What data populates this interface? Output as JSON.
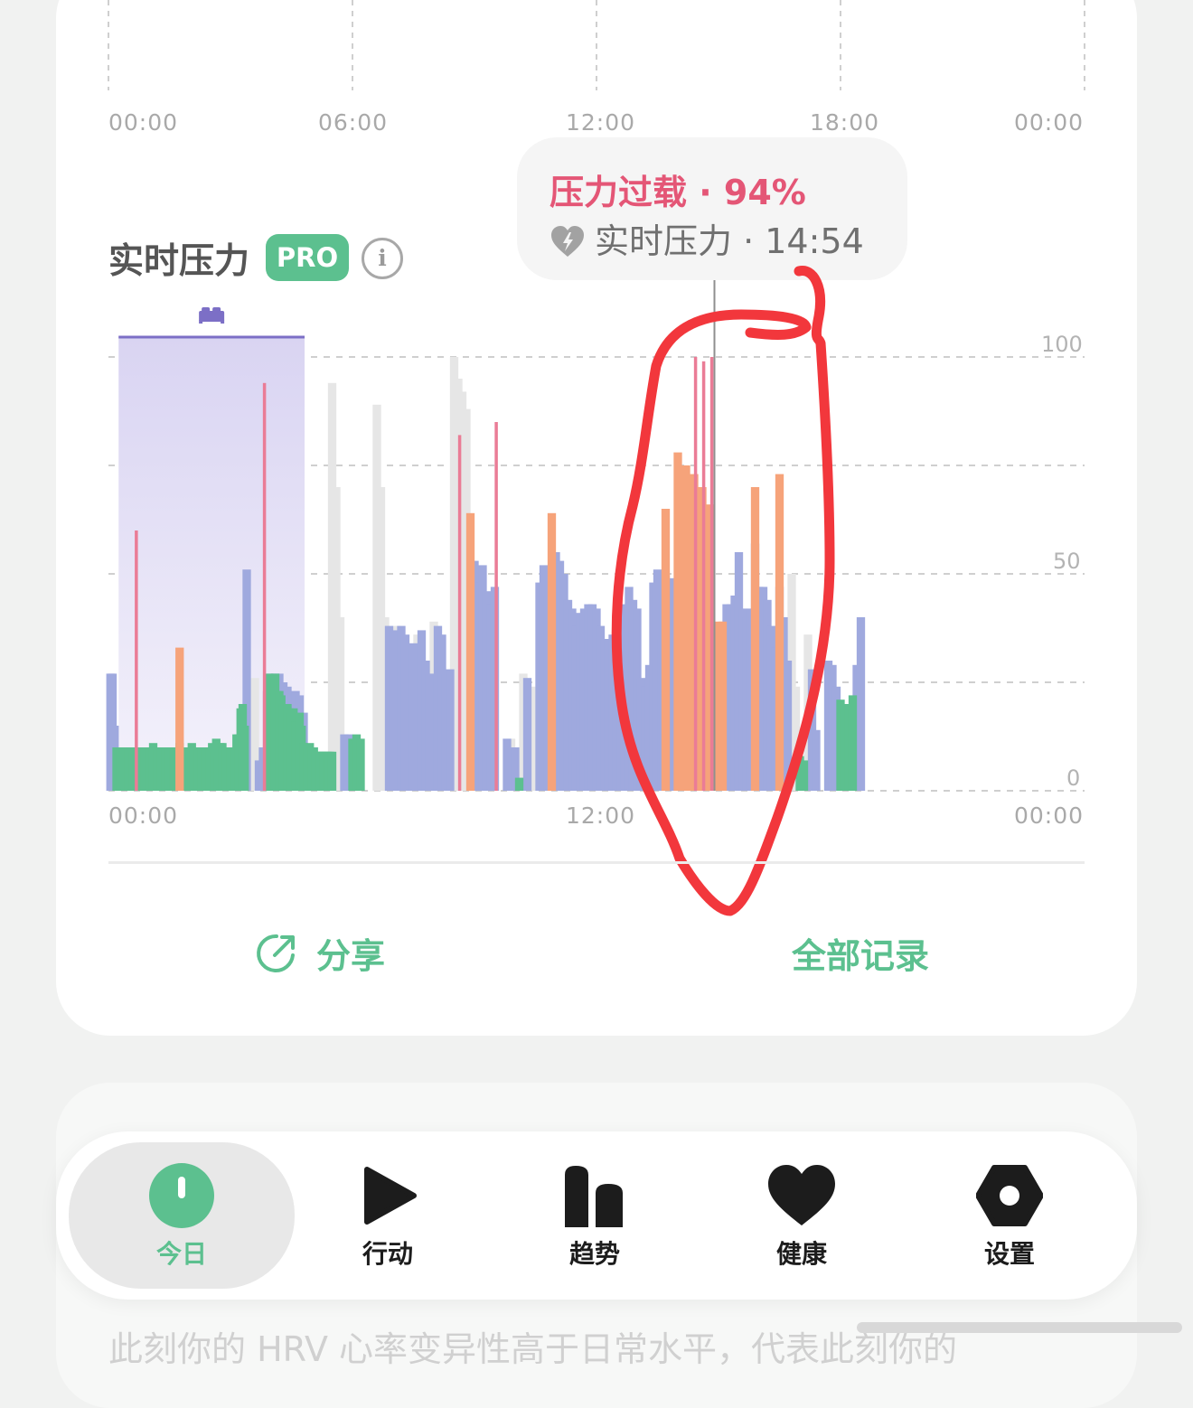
{
  "top_axis": {
    "ticks": [
      "00:00",
      "06:00",
      "12:00",
      "18:00",
      "00:00"
    ]
  },
  "section": {
    "title": "实时压力",
    "badge": "PRO",
    "info_glyph": "i"
  },
  "tooltip": {
    "status": "压力过载 · 94%",
    "label": "实时压力 · 14:54",
    "status_color": "#e45676",
    "icon": "heart-bolt-icon"
  },
  "sleep_icon": "bed-icon",
  "colors": {
    "accent": "#5cc08f",
    "calm": "#5cc08f",
    "normal": "#9fa9de",
    "medium": "#f6a37a",
    "high": "#ea7c96",
    "no_data": "#e6e6e6",
    "sleep": "#7c6fc6",
    "annotation": "#f2373c"
  },
  "chart_data": {
    "type": "bar",
    "x_range": [
      "00:00",
      "24:00"
    ],
    "xticks": [
      "00:00",
      "12:00",
      "00:00"
    ],
    "yticks": [
      0,
      50,
      100
    ],
    "ylim": [
      0,
      100
    ],
    "grid": true,
    "sleep_period": {
      "start": "00:15",
      "end": "05:00"
    },
    "cursor": {
      "time": "14:54",
      "value": 94
    },
    "bars": [
      [
        0.1,
        27,
        "n"
      ],
      [
        0.2,
        27,
        "n"
      ],
      [
        0.3,
        15,
        "n"
      ],
      [
        0.4,
        10,
        "g"
      ],
      [
        0.5,
        10,
        "g"
      ],
      [
        0.6,
        10,
        "g"
      ],
      [
        0.7,
        10,
        "g"
      ],
      [
        0.8,
        10,
        "n"
      ],
      [
        0.9,
        10,
        "g"
      ],
      [
        1.0,
        10,
        "g"
      ],
      [
        1.1,
        10,
        "g"
      ],
      [
        1.2,
        9,
        "g"
      ],
      [
        1.3,
        9,
        "g"
      ],
      [
        1.4,
        10,
        "g"
      ],
      [
        1.5,
        10,
        "g"
      ],
      [
        1.6,
        10,
        "g"
      ],
      [
        1.7,
        10,
        "g"
      ],
      [
        1.8,
        10,
        "g"
      ],
      [
        1.9,
        10,
        "g"
      ],
      [
        2.0,
        10,
        "g"
      ],
      [
        2.1,
        10,
        "g"
      ],
      [
        2.2,
        11,
        "g"
      ],
      [
        2.3,
        10,
        "g"
      ],
      [
        2.4,
        10,
        "g"
      ],
      [
        2.5,
        10,
        "g"
      ],
      [
        2.6,
        10,
        "g"
      ],
      [
        2.7,
        10,
        "g"
      ],
      [
        2.8,
        10,
        "g"
      ],
      [
        2.9,
        10,
        "g"
      ],
      [
        3.0,
        10,
        "g"
      ],
      [
        3.1,
        10,
        "g"
      ],
      [
        3.2,
        10,
        "g"
      ],
      [
        3.3,
        10,
        "g"
      ],
      [
        3.4,
        10,
        "g"
      ],
      [
        3.5,
        11,
        "g"
      ],
      [
        3.6,
        10,
        "g"
      ],
      [
        3.7,
        10,
        "g"
      ],
      [
        3.8,
        10,
        "g"
      ],
      [
        3.9,
        10,
        "g"
      ],
      [
        4.0,
        10,
        "g"
      ],
      [
        4.1,
        11,
        "g"
      ],
      [
        4.2,
        10,
        "g"
      ],
      [
        4.3,
        10,
        "g"
      ],
      [
        4.4,
        10,
        "g"
      ],
      [
        4.5,
        10,
        "g"
      ],
      [
        4.6,
        10,
        "g"
      ],
      [
        4.7,
        10,
        "g"
      ],
      [
        4.8,
        10,
        "g"
      ],
      [
        4.9,
        10,
        "g"
      ],
      [
        5.0,
        10,
        "g"
      ],
      [
        5.1,
        11,
        "g"
      ],
      [
        5.2,
        9,
        "g"
      ],
      [
        5.3,
        12,
        "g"
      ],
      [
        5.4,
        8,
        "g"
      ],
      [
        5.5,
        11,
        "g"
      ],
      [
        5.6,
        11,
        "g"
      ],
      [
        5.7,
        10,
        "g"
      ],
      [
        5.8,
        10,
        "g"
      ],
      [
        5.9,
        10,
        "g"
      ],
      [
        6.0,
        10,
        "g"
      ],
      [
        6.1,
        10,
        "g"
      ],
      [
        6.2,
        10,
        "g"
      ],
      [
        6.3,
        13,
        "g"
      ],
      [
        6.4,
        13,
        "g"
      ],
      [
        6.5,
        19,
        "g"
      ],
      [
        6.6,
        20,
        "g"
      ],
      [
        6.7,
        15,
        "g"
      ],
      [
        6.8,
        51,
        "n"
      ],
      [
        1.5,
        60,
        "r"
      ],
      [
        3.5,
        33,
        "o"
      ],
      [
        5.8,
        6,
        "n"
      ],
      [
        6.0,
        8,
        "n"
      ],
      [
        6.2,
        3,
        "n"
      ],
      [
        6.4,
        10,
        "n"
      ],
      [
        7.0,
        20,
        "e"
      ],
      [
        7.2,
        26,
        "e"
      ],
      [
        7.4,
        7,
        "n"
      ],
      [
        7.6,
        10,
        "n"
      ],
      [
        7.8,
        23,
        "n"
      ],
      [
        8.0,
        27,
        "n"
      ],
      [
        8.2,
        27,
        "n"
      ],
      [
        8.4,
        27,
        "n"
      ],
      [
        8.6,
        25,
        "n"
      ],
      [
        8.8,
        24,
        "n"
      ],
      [
        9.0,
        20,
        "n"
      ],
      [
        9.2,
        23,
        "n"
      ],
      [
        9.4,
        22,
        "n"
      ],
      [
        9.6,
        18,
        "n"
      ],
      [
        7.8,
        94,
        "r"
      ],
      [
        7.9,
        27,
        "g"
      ],
      [
        8.0,
        25,
        "g"
      ],
      [
        8.1,
        26,
        "g"
      ],
      [
        8.2,
        27,
        "g"
      ],
      [
        8.3,
        23,
        "g"
      ],
      [
        8.4,
        23,
        "g"
      ],
      [
        8.5,
        22,
        "g"
      ],
      [
        8.6,
        20,
        "g"
      ],
      [
        8.7,
        20,
        "g"
      ],
      [
        8.8,
        20,
        "g"
      ],
      [
        8.9,
        19,
        "g"
      ],
      [
        9.0,
        18,
        "g"
      ],
      [
        9.1,
        19,
        "g"
      ],
      [
        9.2,
        16,
        "g"
      ],
      [
        9.3,
        16,
        "g"
      ],
      [
        9.4,
        18,
        "g"
      ],
      [
        9.5,
        15,
        "g"
      ],
      [
        9.6,
        11,
        "g"
      ],
      [
        9.7,
        10,
        "g"
      ],
      [
        9.8,
        10,
        "g"
      ],
      [
        9.9,
        11,
        "g"
      ],
      [
        10.0,
        10,
        "g"
      ],
      [
        10.1,
        10,
        "g"
      ],
      [
        10.2,
        9,
        "g"
      ],
      [
        10.3,
        9,
        "g"
      ],
      [
        10.4,
        9,
        "g"
      ],
      [
        10.5,
        9,
        "g"
      ],
      [
        10.6,
        9,
        "g"
      ],
      [
        10.7,
        9,
        "g"
      ],
      [
        10.8,
        9,
        "g"
      ],
      [
        10.9,
        9,
        "g"
      ],
      [
        11.0,
        9,
        "g"
      ],
      [
        11.0,
        94,
        "e"
      ],
      [
        11.2,
        70,
        "e"
      ],
      [
        11.4,
        40,
        "e"
      ],
      [
        11.6,
        13,
        "n"
      ],
      [
        11.8,
        13,
        "n"
      ],
      [
        12.0,
        12,
        "g"
      ],
      [
        12.2,
        13,
        "g"
      ],
      [
        12.4,
        12,
        "g"
      ],
      [
        13.2,
        89,
        "e"
      ],
      [
        13.4,
        70,
        "e"
      ],
      [
        13.6,
        40,
        "e"
      ],
      [
        13.8,
        38,
        "n"
      ],
      [
        14.0,
        37,
        "n"
      ],
      [
        14.2,
        38,
        "e"
      ],
      [
        14.4,
        38,
        "n"
      ],
      [
        14.6,
        36,
        "n"
      ],
      [
        14.8,
        33,
        "e"
      ],
      [
        15.0,
        34,
        "n"
      ],
      [
        15.2,
        36,
        "e"
      ],
      [
        15.4,
        37,
        "n"
      ],
      [
        15.6,
        30,
        "n"
      ],
      [
        15.8,
        27,
        "n"
      ],
      [
        16.0,
        39,
        "e"
      ],
      [
        16.2,
        38,
        "n"
      ],
      [
        16.4,
        36,
        "n"
      ],
      [
        16.6,
        27,
        "n"
      ],
      [
        16.8,
        28,
        "n"
      ],
      [
        17.0,
        100,
        "e"
      ],
      [
        17.2,
        95,
        "e"
      ],
      [
        17.4,
        92,
        "e"
      ],
      [
        17.6,
        88,
        "e"
      ],
      [
        17.8,
        64,
        "o"
      ],
      [
        18.0,
        53,
        "n"
      ],
      [
        18.2,
        48,
        "n"
      ],
      [
        18.4,
        52,
        "n"
      ],
      [
        18.6,
        46,
        "n"
      ],
      [
        18.8,
        43,
        "n"
      ],
      [
        19.0,
        47,
        "n"
      ],
      [
        17.4,
        82,
        "r"
      ],
      [
        19.2,
        85,
        "r"
      ],
      [
        19.6,
        12,
        "n"
      ],
      [
        19.8,
        12,
        "e"
      ],
      [
        20.0,
        10,
        "n"
      ],
      [
        20.2,
        3,
        "g"
      ],
      [
        20.4,
        27,
        "e"
      ],
      [
        20.6,
        26,
        "n"
      ],
      [
        20.8,
        24,
        "e"
      ],
      [
        21.0,
        22,
        "e"
      ],
      [
        21.2,
        48,
        "n"
      ],
      [
        21.4,
        52,
        "n"
      ],
      [
        21.6,
        45,
        "n"
      ],
      [
        21.8,
        64,
        "o"
      ],
      [
        22.0,
        55,
        "n"
      ],
      [
        22.2,
        53,
        "n"
      ],
      [
        22.4,
        50,
        "n"
      ],
      [
        22.6,
        44,
        "n"
      ],
      [
        22.8,
        42,
        "n"
      ],
      [
        23.0,
        38,
        "n"
      ],
      [
        23.2,
        41,
        "n"
      ],
      [
        23.4,
        42,
        "n"
      ],
      [
        23.6,
        43,
        "n"
      ],
      [
        23.8,
        43,
        "n"
      ],
      [
        24.0,
        42,
        "n"
      ],
      [
        24.2,
        38,
        "n"
      ],
      [
        24.4,
        35,
        "n"
      ],
      [
        24.6,
        35,
        "n"
      ],
      [
        24.8,
        36,
        "n"
      ],
      [
        25.0,
        38,
        "n"
      ],
      [
        25.2,
        43,
        "n"
      ],
      [
        25.4,
        35,
        "n"
      ],
      [
        25.6,
        47,
        "n"
      ],
      [
        25.8,
        44,
        "n"
      ],
      [
        26.0,
        42,
        "n"
      ],
      [
        26.2,
        26,
        "n"
      ],
      [
        26.4,
        24,
        "n"
      ],
      [
        26.6,
        29,
        "n"
      ],
      [
        26.8,
        48,
        "n"
      ],
      [
        27.0,
        51,
        "n"
      ],
      [
        27.2,
        35,
        "n"
      ],
      [
        27.4,
        50,
        "n"
      ],
      [
        27.6,
        49,
        "n"
      ],
      [
        27.8,
        40,
        "n"
      ],
      [
        28.0,
        42,
        "n"
      ],
      [
        27.4,
        65,
        "o"
      ],
      [
        28.2,
        64,
        "o"
      ],
      [
        28.6,
        64,
        "o"
      ],
      [
        28.8,
        47,
        "o"
      ],
      [
        29.0,
        100,
        "r"
      ],
      [
        29.2,
        50,
        "o"
      ],
      [
        29.4,
        99,
        "r"
      ],
      [
        29.6,
        66,
        "o"
      ],
      [
        29.8,
        100,
        "r"
      ],
      [
        30.0,
        39,
        "o"
      ],
      [
        30.2,
        39,
        "o"
      ],
      [
        28.0,
        78,
        "o"
      ],
      [
        28.4,
        75,
        "o"
      ],
      [
        28.8,
        73,
        "o"
      ],
      [
        29.2,
        70,
        "o"
      ],
      [
        29.6,
        64,
        "o"
      ],
      [
        30.4,
        43,
        "n"
      ],
      [
        30.6,
        43,
        "n"
      ],
      [
        30.8,
        45,
        "n"
      ],
      [
        31.0,
        55,
        "n"
      ],
      [
        31.2,
        42,
        "n"
      ],
      [
        31.4,
        40,
        "n"
      ],
      [
        31.6,
        42,
        "n"
      ],
      [
        31.8,
        57,
        "n"
      ],
      [
        32.0,
        47,
        "n"
      ],
      [
        32.2,
        47,
        "n"
      ],
      [
        32.4,
        44,
        "n"
      ],
      [
        32.6,
        38,
        "n"
      ],
      [
        32.8,
        33,
        "n"
      ],
      [
        33.0,
        47,
        "n"
      ],
      [
        33.2,
        40,
        "n"
      ],
      [
        33.4,
        30,
        "n"
      ],
      [
        31.8,
        70,
        "o"
      ],
      [
        33.0,
        73,
        "o"
      ],
      [
        33.6,
        50,
        "e"
      ],
      [
        33.8,
        24,
        "e"
      ],
      [
        34.0,
        8,
        "g"
      ],
      [
        34.2,
        7,
        "g"
      ],
      [
        34.4,
        36,
        "e"
      ],
      [
        34.6,
        28,
        "n"
      ],
      [
        34.8,
        14,
        "n"
      ],
      [
        35.4,
        30,
        "n"
      ],
      [
        35.6,
        29,
        "n"
      ],
      [
        35.8,
        24,
        "n"
      ],
      [
        36.0,
        21,
        "g"
      ],
      [
        36.2,
        20,
        "g"
      ],
      [
        36.4,
        20,
        "g"
      ],
      [
        36.6,
        22,
        "g"
      ],
      [
        36.8,
        29,
        "n"
      ],
      [
        37.0,
        40,
        "n"
      ]
    ]
  },
  "share": {
    "label": "分享",
    "icon": "share-icon"
  },
  "all_records": {
    "label": "全部记录"
  },
  "background_text": "此刻你的 HRV 心率变异性高于日常水平，代表此刻你的",
  "tabs": [
    {
      "label": "今日",
      "icon": "today-icon",
      "active": true
    },
    {
      "label": "行动",
      "icon": "play-icon",
      "active": false
    },
    {
      "label": "趋势",
      "icon": "trend-icon",
      "active": false
    },
    {
      "label": "健康",
      "icon": "heart-icon",
      "active": false
    },
    {
      "label": "设置",
      "icon": "settings-icon",
      "active": false
    }
  ]
}
